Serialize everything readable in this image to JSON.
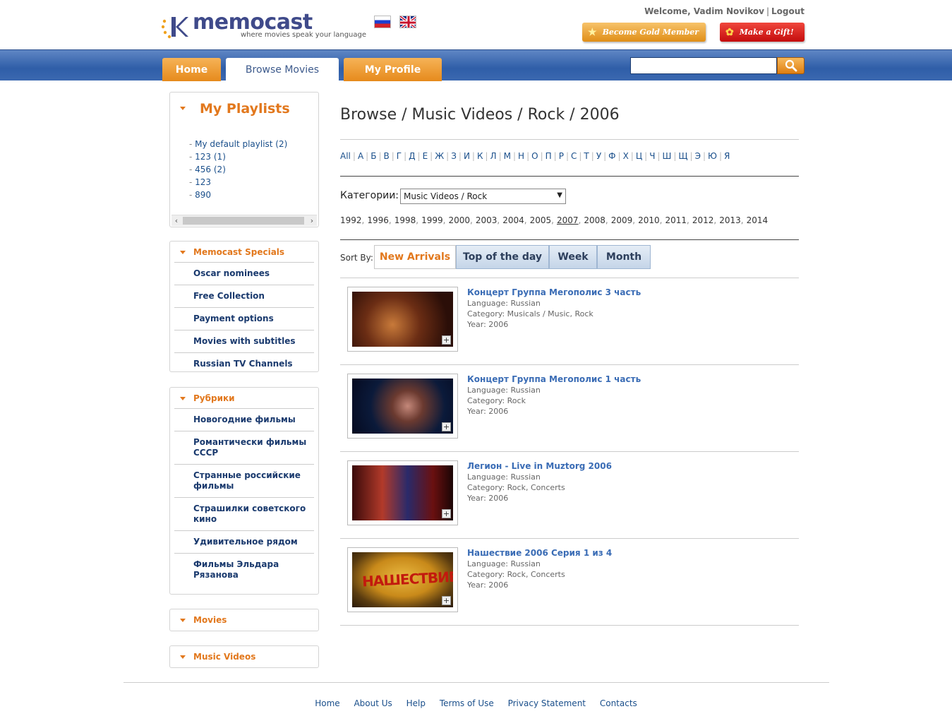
{
  "header": {
    "logo_word": "memocast",
    "logo_tagline": "where movies speak your language",
    "welcome": "Welcome, Vadim Novikov",
    "logout": "Logout",
    "gold_button": "Become Gold Member",
    "gift_button": "Make a Gift!"
  },
  "nav": {
    "home": "Home",
    "browse": "Browse Movies",
    "profile": "My Profile",
    "search_value": ""
  },
  "sidebar": {
    "playlists_title": "My Playlists",
    "playlists": [
      "My default playlist (2)",
      "123 (1)",
      "456 (2)",
      "123",
      "890"
    ],
    "specials_title": "Memocast Specials",
    "specials": [
      "Oscar nominees",
      "Free Collection",
      "Payment options",
      "Movies with subtitles",
      "Russian TV Channels"
    ],
    "rubriki_title": "Рубрики",
    "rubriki": [
      "Новогодние фильмы",
      "Романтически фильмы СССР",
      "Странные российские фильмы",
      "Страшилки советского кино",
      "Удивительное рядом",
      "Фильмы Эльдара Рязанова"
    ],
    "movies_title": "Movies",
    "music_videos_title": "Music Videos"
  },
  "main": {
    "breadcrumb": "Browse / Music Videos / Rock / 2006",
    "alphabet": [
      "All",
      "А",
      "Б",
      "В",
      "Г",
      "Д",
      "Е",
      "Ж",
      "З",
      "И",
      "К",
      "Л",
      "М",
      "Н",
      "О",
      "П",
      "Р",
      "С",
      "Т",
      "У",
      "Ф",
      "Х",
      "Ц",
      "Ч",
      "Ш",
      "Щ",
      "Э",
      "Ю",
      "Я"
    ],
    "category_label": "Категории:",
    "category_value": "Music Videos / Rock",
    "years": [
      "1992",
      "1996",
      "1998",
      "1999",
      "2000",
      "2003",
      "2004",
      "2005",
      "2007",
      "2008",
      "2009",
      "2010",
      "2011",
      "2012",
      "2013",
      "2014"
    ],
    "selected_year": "2007",
    "sort_label": "Sort By:",
    "sort_tabs": [
      "New Arrivals",
      "Top of the day",
      "Week",
      "Month"
    ],
    "active_sort": "New Arrivals"
  },
  "videos": [
    {
      "title": "Концерт Группа Мегополис 3 часть",
      "language": "Language: Russian",
      "category": "Category: Musicals / Music, Rock",
      "year": "Year: 2006"
    },
    {
      "title": "Концерт Группа Мегополис 1 часть",
      "language": "Language: Russian",
      "category": "Category: Rock",
      "year": "Year: 2006"
    },
    {
      "title": "Легион - Live in Muztorg 2006",
      "language": "Language: Russian",
      "category": "Category: Rock, Concerts",
      "year": "Year: 2006"
    },
    {
      "title": "Нашествие 2006 Серия 1 из 4",
      "language": "Language: Russian",
      "category": "Category: Rock, Concerts",
      "year": "Year: 2006"
    }
  ],
  "thumb4_text": "НАШЕСТВИЕ",
  "footer": [
    "Home",
    "About Us",
    "Help",
    "Terms of Use",
    "Privacy Statement",
    "Contacts"
  ],
  "colors": {
    "accent_orange": "#e2781d",
    "nav_blue": "#2f5ea8",
    "link_blue": "#1a4f8b"
  }
}
